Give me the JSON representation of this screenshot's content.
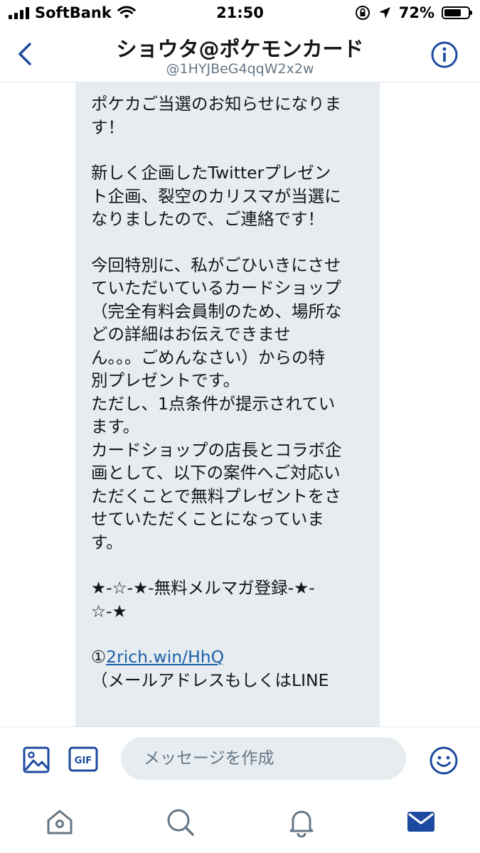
{
  "status_bar": {
    "carrier": "SoftBank",
    "time": "21:50",
    "battery": "72%",
    "battery_level": 0.72,
    "icons": [
      "signal-icon",
      "wifi-icon",
      "orientation-lock-icon",
      "location-icon",
      "battery-icon"
    ]
  },
  "header": {
    "title": "ショウタ@ポケモンカード",
    "handle": "@1HYJBeG4qqW2x2w",
    "icons": [
      "back-icon",
      "info-icon"
    ]
  },
  "message": {
    "lines": [
      "ポケカご当選のお知らせになりま",
      "す！",
      "",
      "新しく企画したTwitterプレゼン",
      "ト企画、裂空のカリスマが当選に",
      "なりましたので、ご連絡です！",
      "",
      "今回特別に、私がごひいきにさせ",
      "ていただいているカードショップ",
      "（完全有料会員制のため、場所な",
      "どの詳細はお伝えできませ",
      "ん。。。ごめんなさい）からの特",
      "別プレゼントです。",
      "ただし、1点条件が提示されてい",
      "ます。",
      "カードショップの店長とコラボ企",
      "画として、以下の案件へご対応い",
      "ただくことで無料プレゼントをさ",
      "せていただくことになっていま",
      "す。",
      "",
      "★-☆-★-無料メルマガ登録-★-",
      "☆-★",
      ""
    ],
    "link_prefix": "①",
    "link_text": "2rich.win/HhQ",
    "last_line": "（メールアドレスもしくはLINE"
  },
  "composer": {
    "placeholder": "メッセージを作成",
    "gif_label": "GIF",
    "icons": [
      "image-icon",
      "gif-icon",
      "emoji-icon"
    ]
  },
  "tabbar": {
    "icons": [
      "home-icon",
      "search-icon",
      "notifications-icon",
      "messages-icon"
    ],
    "active": "messages-icon"
  },
  "colors": {
    "accent": "#1d4aa0",
    "bubble": "#e6ecf0",
    "text": "#14171a",
    "secondary": "#657786",
    "tab_inactive": "#657786"
  }
}
